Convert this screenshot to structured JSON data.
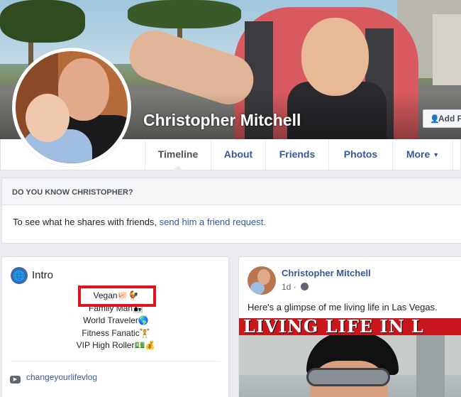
{
  "profile": {
    "name": "Christopher Mitchell",
    "add_button_label": "Add F"
  },
  "tabs": [
    {
      "label": "Timeline",
      "active": true
    },
    {
      "label": "About"
    },
    {
      "label": "Friends"
    },
    {
      "label": "Photos"
    },
    {
      "label": "More"
    }
  ],
  "know_box": {
    "heading": "DO YOU KNOW CHRISTOPHER?",
    "text": "To see what he shares with friends, ",
    "link": "send him a friend request."
  },
  "intro": {
    "title": "Intro",
    "lines": [
      "Vegan🐖🐓",
      "Family Man👨‍👧",
      "World Traveler🌎",
      "Fitness Fanatic🏋",
      "VIP High Roller💵💰"
    ],
    "youtube_label": "changeyourlifevlog"
  },
  "post": {
    "author": "Christopher Mitchell",
    "time": "1d",
    "text": "Here's a glimpse of me living life in Las Vegas.",
    "banner": "LIVING LIFE IN L"
  },
  "colors": {
    "link": "#365899",
    "highlight_box": "#e0141e",
    "page_bg": "#e9ebee"
  }
}
